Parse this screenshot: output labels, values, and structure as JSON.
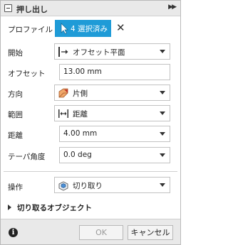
{
  "title": "押し出し",
  "profile": {
    "label": "プロファイル",
    "selection": "4 選択済み"
  },
  "start": {
    "label": "開始",
    "value": "オフセット平面"
  },
  "offset": {
    "label": "オフセット",
    "value": "13.00 mm"
  },
  "direction": {
    "label": "方向",
    "value": "片側"
  },
  "extent": {
    "label": "範囲",
    "value": "距離"
  },
  "distance": {
    "label": "距離",
    "value": "4.00 mm"
  },
  "taper": {
    "label": "テーパ角度",
    "value": "0.0 deg"
  },
  "operation": {
    "label": "操作",
    "value": "切り取り"
  },
  "objects_to_cut": {
    "label": "切り取るオブジェクト"
  },
  "footer": {
    "ok": "OK",
    "cancel": "キャンセル"
  },
  "colors": {
    "accent": "#1f9bd7"
  }
}
